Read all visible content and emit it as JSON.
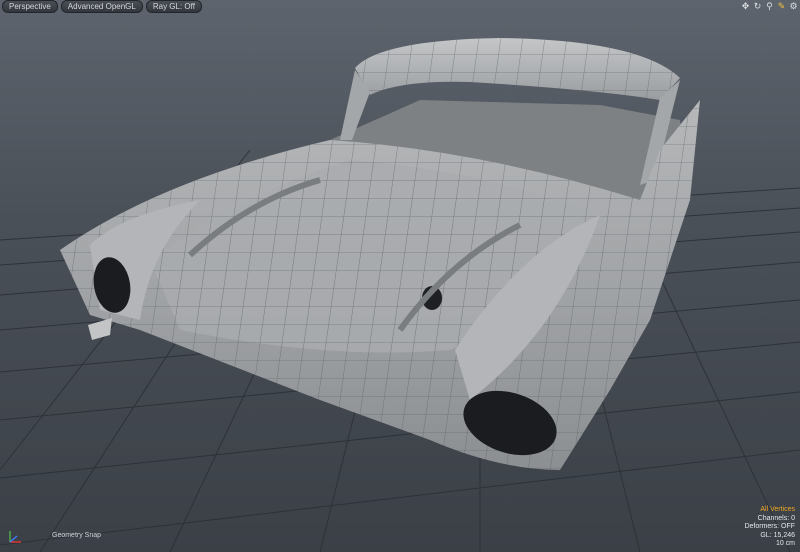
{
  "viewport_tabs": [
    {
      "label": "Perspective"
    },
    {
      "label": "Advanced OpenGL"
    },
    {
      "label": "Ray GL: Off"
    }
  ],
  "tool_icons": [
    "move-view-icon",
    "rotate-view-icon",
    "zoom-view-icon",
    "pencil-icon",
    "gear-icon"
  ],
  "status": {
    "snap_label": "Geometry Snap",
    "selection_mode": "All Vertices",
    "channels": "Channels: 0",
    "deformers": "Deformers: OFF",
    "gl": "GL: 15,246",
    "grid_size": "10 cm"
  },
  "colors": {
    "viewport_bg_top": "#5e646d",
    "viewport_bg_bottom": "#3b4047",
    "grid_line": "#2a2f35",
    "model_surface": "#9c9fa2",
    "wire": "#55585c",
    "highlight_text": "#f0a623"
  }
}
